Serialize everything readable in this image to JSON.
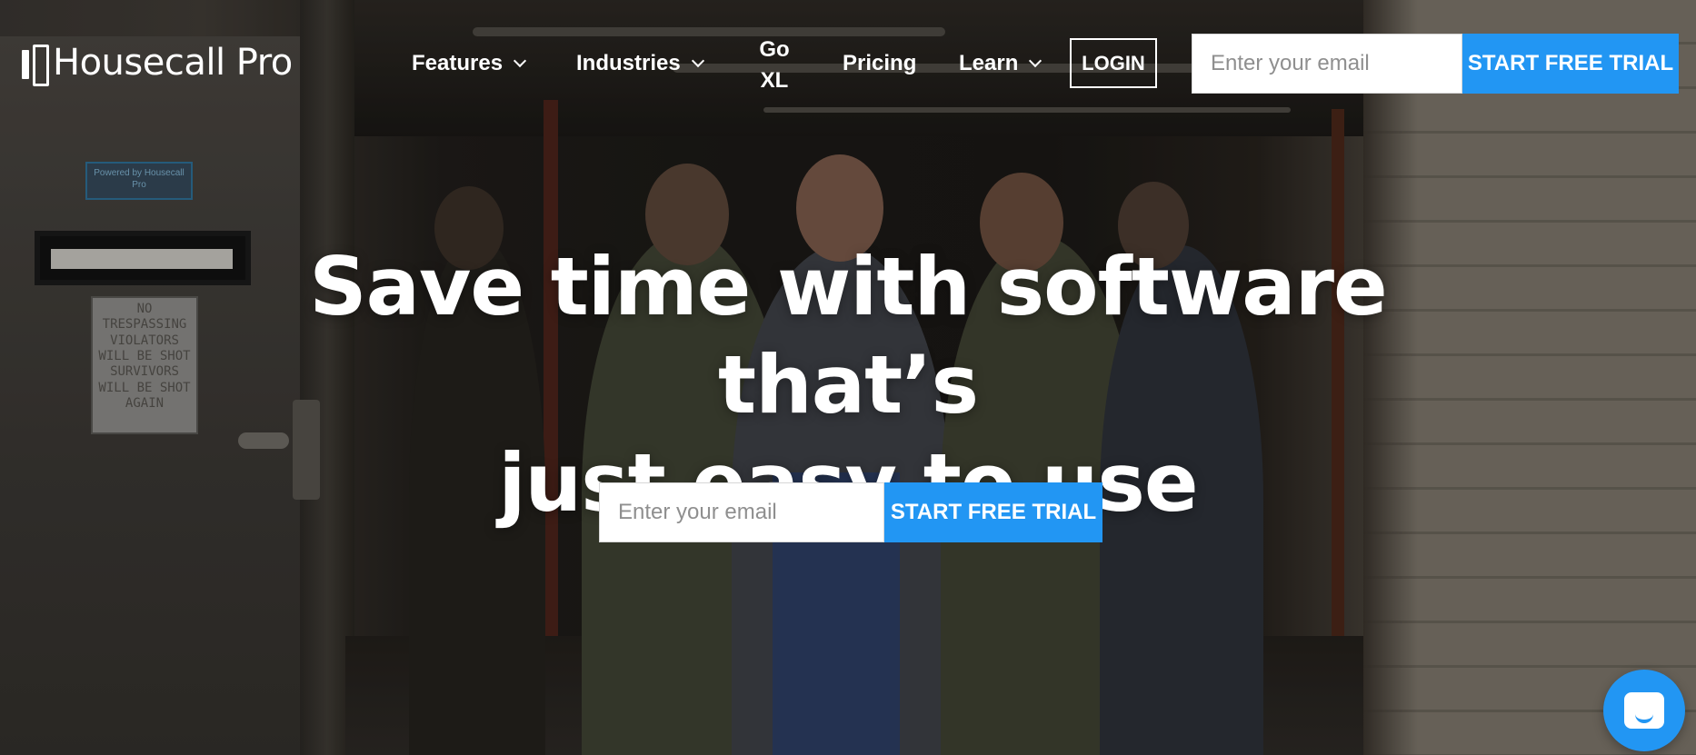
{
  "header": {
    "logo_text": "Housecall Pro",
    "nav": [
      {
        "label": "Features",
        "has_dropdown": true
      },
      {
        "label": "Industries",
        "has_dropdown": true
      },
      {
        "label_line1": "Go",
        "label_line2": "XL",
        "has_dropdown": false
      },
      {
        "label": "Pricing",
        "has_dropdown": false
      },
      {
        "label": "Learn",
        "has_dropdown": true
      }
    ],
    "login_label": "LOGIN",
    "email_placeholder": "Enter your email",
    "cta_label": "START FREE TRIAL"
  },
  "hero": {
    "title_line1": "Save time with software that’s",
    "title_line2": "just easy to use",
    "email_placeholder": "Enter your email",
    "cta_label": "START FREE TRIAL"
  },
  "background": {
    "sign_powered": "Powered by Housecall Pro",
    "sign_trespassing": [
      "NO",
      "TRESPASSING",
      "VIOLATORS",
      "WILL BE SHOT",
      "SURVIVORS",
      "WILL BE SHOT",
      "AGAIN"
    ]
  },
  "colors": {
    "accent": "#2296f3",
    "text_on_dark": "#ffffff"
  },
  "icons": {
    "logo": "housecall-pro-logo-icon",
    "dropdown": "chevron-down-icon",
    "chat": "chat-bubble-icon"
  }
}
